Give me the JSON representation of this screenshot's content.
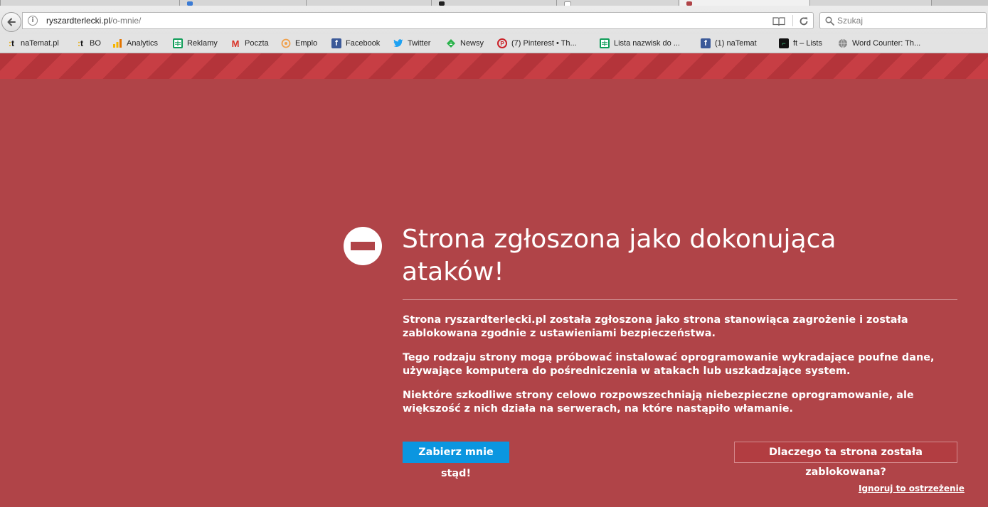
{
  "browser": {
    "url": {
      "domain": "ryszardterlecki.pl",
      "path": "/o-mnie/"
    },
    "search": {
      "placeholder": "Szukaj"
    },
    "bookmarks": [
      {
        "label": "naTemat.pl",
        "icon": "natemat-icon"
      },
      {
        "label": "BO",
        "icon": "natemat-icon"
      },
      {
        "label": "Analytics",
        "icon": "analytics-icon"
      },
      {
        "label": "Reklamy",
        "icon": "sheets-icon"
      },
      {
        "label": "Poczta",
        "icon": "gmail-icon"
      },
      {
        "label": "Emplo",
        "icon": "emplo-icon"
      },
      {
        "label": "Facebook",
        "icon": "facebook-icon"
      },
      {
        "label": "Twitter",
        "icon": "twitter-icon"
      },
      {
        "label": "Newsy",
        "icon": "feedly-icon"
      },
      {
        "label": "(7) Pinterest • Th...",
        "icon": "pinterest-icon"
      },
      {
        "label": "Lista nazwisk do ...",
        "icon": "sheets-icon"
      },
      {
        "label": "(1) naTemat",
        "icon": "facebook-icon"
      },
      {
        "label": "ft – Lists",
        "icon": "ft-icon"
      },
      {
        "label": "Word Counter: Th...",
        "icon": "globe-icon"
      }
    ]
  },
  "warning": {
    "title": "Strona zgłoszona jako dokonująca ataków!",
    "paragraphs": [
      "Strona ryszardterlecki.pl została zgłoszona jako strona stanowiąca zagrożenie i została zablokowana zgodnie z ustawieniami bezpieczeństwa.",
      "Tego rodzaju strony mogą próbować instalować oprogramowanie wykradające poufne dane, używające komputera do pośredniczenia w atakach lub uszkadzające system.",
      "Niektóre szkodliwe strony celowo rozpowszechniają niebezpieczne oprogramowanie, ale większość z nich działa na serwerach, na które nastąpiło włamanie."
    ],
    "primary_button": "Zabierz mnie stąd!",
    "secondary_button": "Dlaczego ta strona została zablokowana?",
    "ignore_link": "Ignoruj to ostrzeżenie"
  },
  "colors": {
    "background": "#b04448",
    "stripe_light": "#c73e44",
    "stripe_dark": "#b4343a",
    "primary_button": "#0b96e0",
    "text": "#ffffff"
  }
}
